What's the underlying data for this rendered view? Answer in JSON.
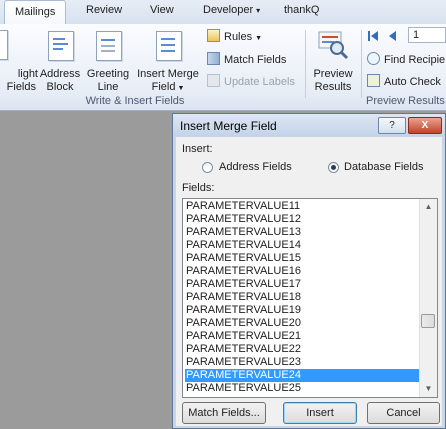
{
  "tabs": [
    {
      "label": "Mailings",
      "active": true
    },
    {
      "label": "Review"
    },
    {
      "label": "View"
    },
    {
      "label": "Developer"
    },
    {
      "label": "thankQ"
    }
  ],
  "ribbon": {
    "highlight_fields": {
      "line1": "light",
      "line2": "Fields"
    },
    "address_block": {
      "line1": "Address",
      "line2": "Block"
    },
    "greeting_line": {
      "line1": "Greeting",
      "line2": "Line"
    },
    "insert_merge_field": {
      "line1": "Insert Merge",
      "line2": "Field"
    },
    "rules": "Rules",
    "match_fields": "Match Fields",
    "update_labels": "Update Labels",
    "write_insert_group": "Write & Insert Fields",
    "preview_results": {
      "line1": "Preview",
      "line2": "Results"
    },
    "record_number": "1",
    "find_recipient": "Find Recipie",
    "auto_check": "Auto Check",
    "preview_group": "Preview Results"
  },
  "dialog": {
    "title": "Insert Merge Field",
    "help_glyph": "?",
    "close_glyph": "X",
    "insert_label": "Insert:",
    "radio_address": "Address Fields",
    "radio_database": "Database Fields",
    "fields_label": "Fields:",
    "fields": [
      "PARAMETERVALUE11",
      "PARAMETERVALUE12",
      "PARAMETERVALUE13",
      "PARAMETERVALUE14",
      "PARAMETERVALUE15",
      "PARAMETERVALUE16",
      "PARAMETERVALUE17",
      "PARAMETERVALUE18",
      "PARAMETERVALUE19",
      "PARAMETERVALUE20",
      "PARAMETERVALUE21",
      "PARAMETERVALUE22",
      "PARAMETERVALUE23",
      "PARAMETERVALUE24",
      "PARAMETERVALUE25"
    ],
    "selected_field": "PARAMETERVALUE24",
    "btn_match": "Match Fields...",
    "btn_insert": "Insert",
    "btn_cancel": "Cancel"
  },
  "colors": {
    "selection": "#3399ff",
    "ribbon_bg": "#e7edf6",
    "dialog_frame": "#c7d5e6"
  }
}
